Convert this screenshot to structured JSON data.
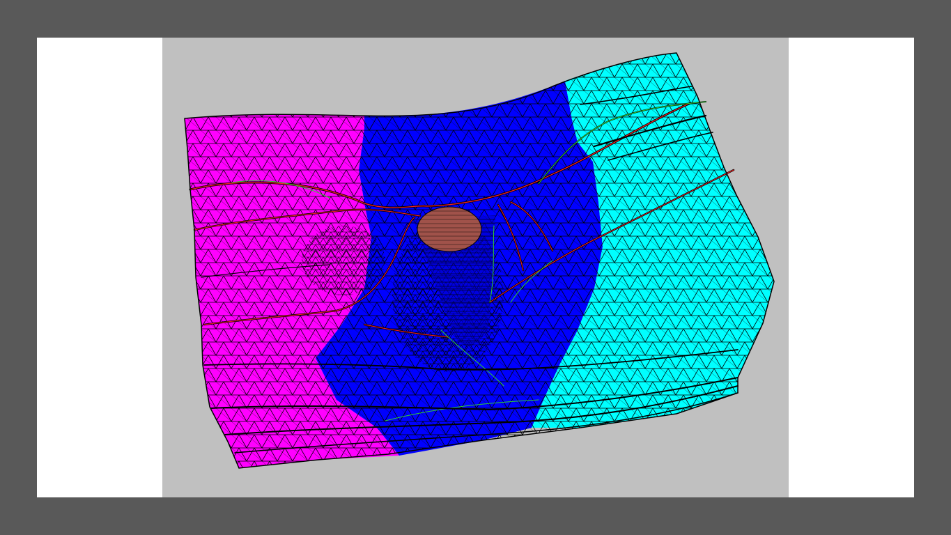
{
  "scene": {
    "description_free": true,
    "frame_color": "#595959",
    "page_color": "#ffffff",
    "viewport_background": "#c0c0c0",
    "regions": [
      {
        "name": "left-block",
        "color": "#ff00ff"
      },
      {
        "name": "middle-block",
        "color": "#0000ff"
      },
      {
        "name": "right-block",
        "color": "#00ffff"
      },
      {
        "name": "pit-floor",
        "color": "#a0524a"
      }
    ],
    "mesh_color": "#000000",
    "fault_colors": [
      "#ff2020",
      "#30d030"
    ]
  }
}
